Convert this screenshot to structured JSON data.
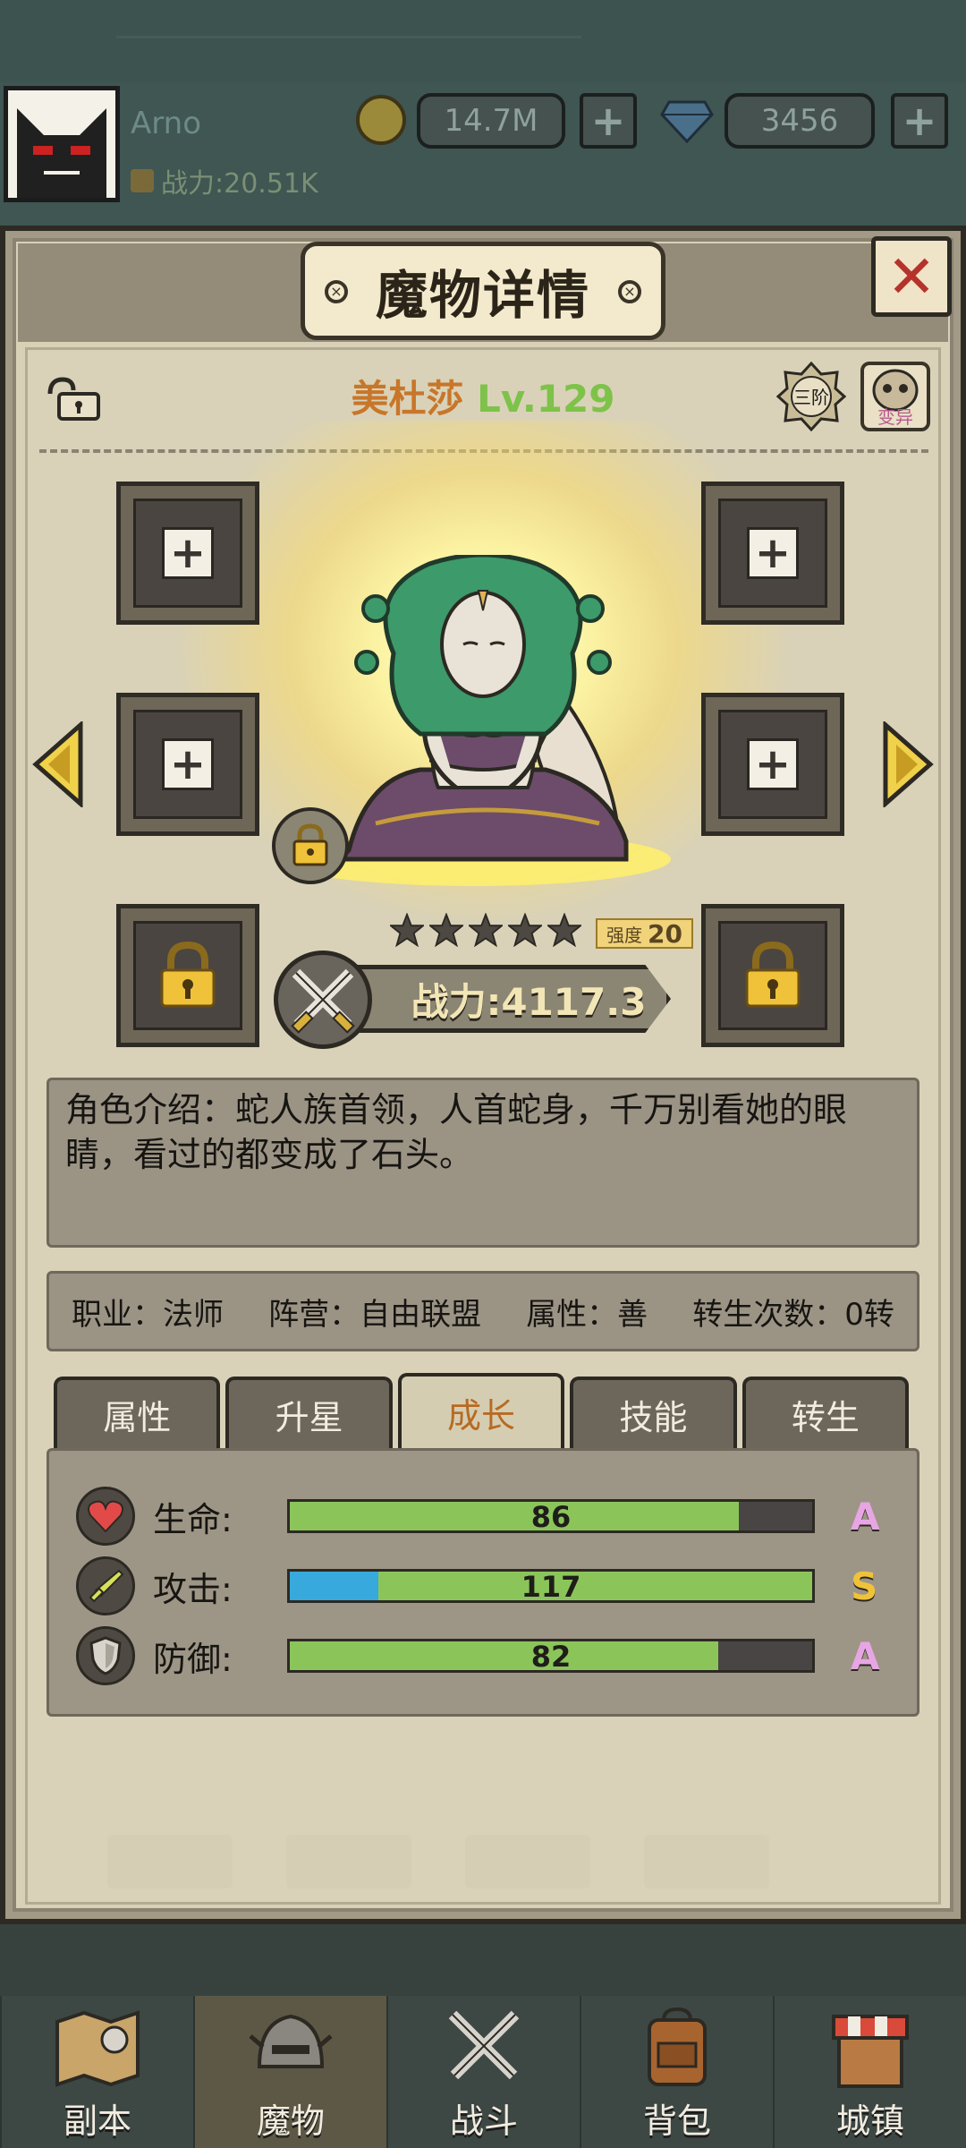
{
  "player": {
    "name": "Arno",
    "power": "战力:20.51K",
    "gold": "14.7M",
    "gems": "3456"
  },
  "panel": {
    "title": "魔物详情",
    "close_label": "✕"
  },
  "monster": {
    "name": "美杜莎",
    "level": "Lv.129",
    "tier": "三阶",
    "mutate": "变异",
    "stars": 5,
    "strength_label": "强度",
    "strength_value": "20",
    "power": "战力:4117.3",
    "description": "角色介绍：蛇人族首领，人首蛇身，千万别看她的眼睛，看过的都变成了石头。",
    "info": {
      "job": "职业：法师",
      "camp": "阵营：自由联盟",
      "attribute": "属性：善",
      "rebirth": "转生次数：0转"
    }
  },
  "tabs": [
    {
      "label": "属性"
    },
    {
      "label": "升星"
    },
    {
      "label": "成长"
    },
    {
      "label": "技能"
    },
    {
      "label": "转生"
    }
  ],
  "growth": [
    {
      "label": "生命:",
      "value": "86",
      "grade": "A",
      "grade_color": "#e7a6e3",
      "fill": 0.86,
      "icon": "heart-icon"
    },
    {
      "label": "攻击:",
      "value": "117",
      "grade": "S",
      "grade_color": "#f0c23a",
      "fill": 1.0,
      "overflow": 0.17,
      "icon": "sword-icon"
    },
    {
      "label": "防御:",
      "value": "82",
      "grade": "A",
      "grade_color": "#e7a6e3",
      "fill": 0.82,
      "icon": "shield-icon"
    }
  ],
  "nav": [
    {
      "label": "副本",
      "icon": "map-icon"
    },
    {
      "label": "魔物",
      "icon": "helmet-icon"
    },
    {
      "label": "战斗",
      "icon": "crossed-swords-icon"
    },
    {
      "label": "背包",
      "icon": "backpack-icon"
    },
    {
      "label": "城镇",
      "icon": "shop-icon"
    }
  ]
}
